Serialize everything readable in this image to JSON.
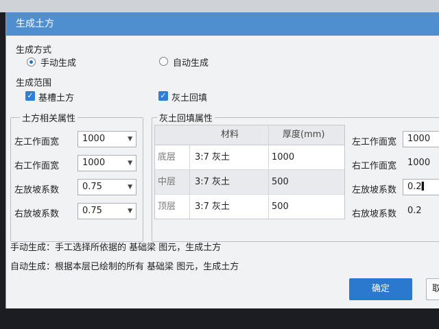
{
  "dialog": {
    "title": "生成土方",
    "gen_method": {
      "label": "生成方式",
      "options": [
        {
          "label": "手动生成",
          "selected": true
        },
        {
          "label": "自动生成",
          "selected": false
        }
      ]
    },
    "gen_range": {
      "label": "生成范围",
      "options": [
        {
          "label": "基槽土方",
          "checked": true
        },
        {
          "label": "灰土回填",
          "checked": true
        }
      ]
    },
    "earth_props": {
      "title": "土方相关属性",
      "rows": [
        {
          "label": "左工作面宽",
          "value": "1000"
        },
        {
          "label": "右工作面宽",
          "value": "1000"
        },
        {
          "label": "左放坡系数",
          "value": "0.75"
        },
        {
          "label": "右放坡系数",
          "value": "0.75"
        }
      ]
    },
    "backfill_props": {
      "title": "灰土回填属性",
      "table": {
        "headers": [
          "材料",
          "厚度(mm)"
        ],
        "rows": [
          {
            "layer": "底层",
            "material": "3:7 灰土",
            "thickness": "1000"
          },
          {
            "layer": "中层",
            "material": "3:7 灰土",
            "thickness": "500"
          },
          {
            "layer": "顶层",
            "material": "3:7 灰土",
            "thickness": "500"
          }
        ]
      },
      "side_rows": [
        {
          "label": "左工作面宽",
          "value": "1000"
        },
        {
          "label": "右工作面宽",
          "value": "1000"
        },
        {
          "label": "左放坡系数",
          "value": "0.2"
        },
        {
          "label": "右放坡系数",
          "value": "0.2"
        }
      ]
    },
    "hints": [
      "手动生成：手工选择所依据的 基础梁 图元，生成土方",
      "自动生成：根据本层已绘制的所有 基础梁 图元，生成土方"
    ],
    "buttons": {
      "ok": "确定",
      "cancel": "取"
    }
  },
  "icons": {
    "dropdown": "chevron-down-icon",
    "check": "check-icon",
    "cursor": "text-cursor-icon"
  },
  "colors": {
    "titlebar": "#4f8fd0",
    "accent": "#2b78cf",
    "background": "#f1f2f4"
  }
}
